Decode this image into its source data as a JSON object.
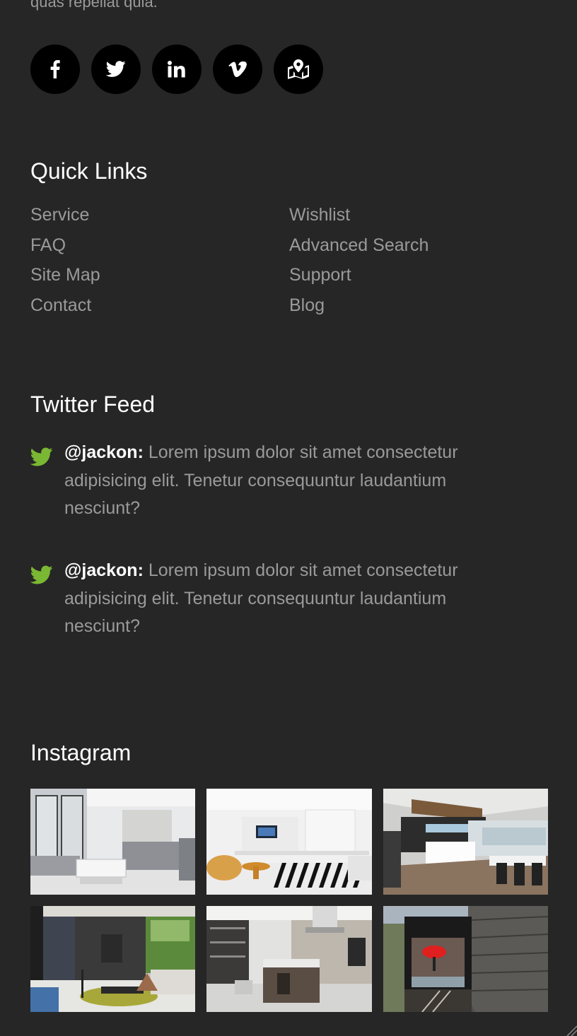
{
  "intro": {
    "tail_text": "quas repellat quia."
  },
  "social": [
    {
      "icon": "facebook-icon"
    },
    {
      "icon": "twitter-icon"
    },
    {
      "icon": "linkedin-icon"
    },
    {
      "icon": "vimeo-icon"
    },
    {
      "icon": "map-icon"
    }
  ],
  "quick_links": {
    "title": "Quick Links",
    "left": [
      "Service",
      "FAQ",
      "Site Map",
      "Contact"
    ],
    "right": [
      "Wishlist",
      "Advanced Search",
      "Support",
      "Blog"
    ]
  },
  "twitter_feed": {
    "title": "Twitter Feed",
    "tweets": [
      {
        "handle": "@jackon:",
        "text": " Lorem ipsum dolor sit amet consectetur adipisicing elit. Tenetur consequuntur laudantium nesciunt?"
      },
      {
        "handle": "@jackon:",
        "text": " Lorem ipsum dolor sit amet consectetur adipisicing elit. Tenetur consequuntur laudantium nesciunt?"
      }
    ]
  },
  "instagram": {
    "title": "Instagram",
    "photos": [
      {
        "subject": "living-room-grey-sofa"
      },
      {
        "subject": "white-living-room-striped-rug"
      },
      {
        "subject": "open-kitchen-dining"
      },
      {
        "subject": "dark-living-room-stone-wall"
      },
      {
        "subject": "modern-kitchen-island"
      },
      {
        "subject": "wood-facade-red-lamp"
      }
    ]
  },
  "colors": {
    "background": "#262626",
    "heading": "#ffffff",
    "body_text": "#9a9a9a",
    "social_circle": "#000000",
    "twitter_bird": "#7ab833"
  }
}
